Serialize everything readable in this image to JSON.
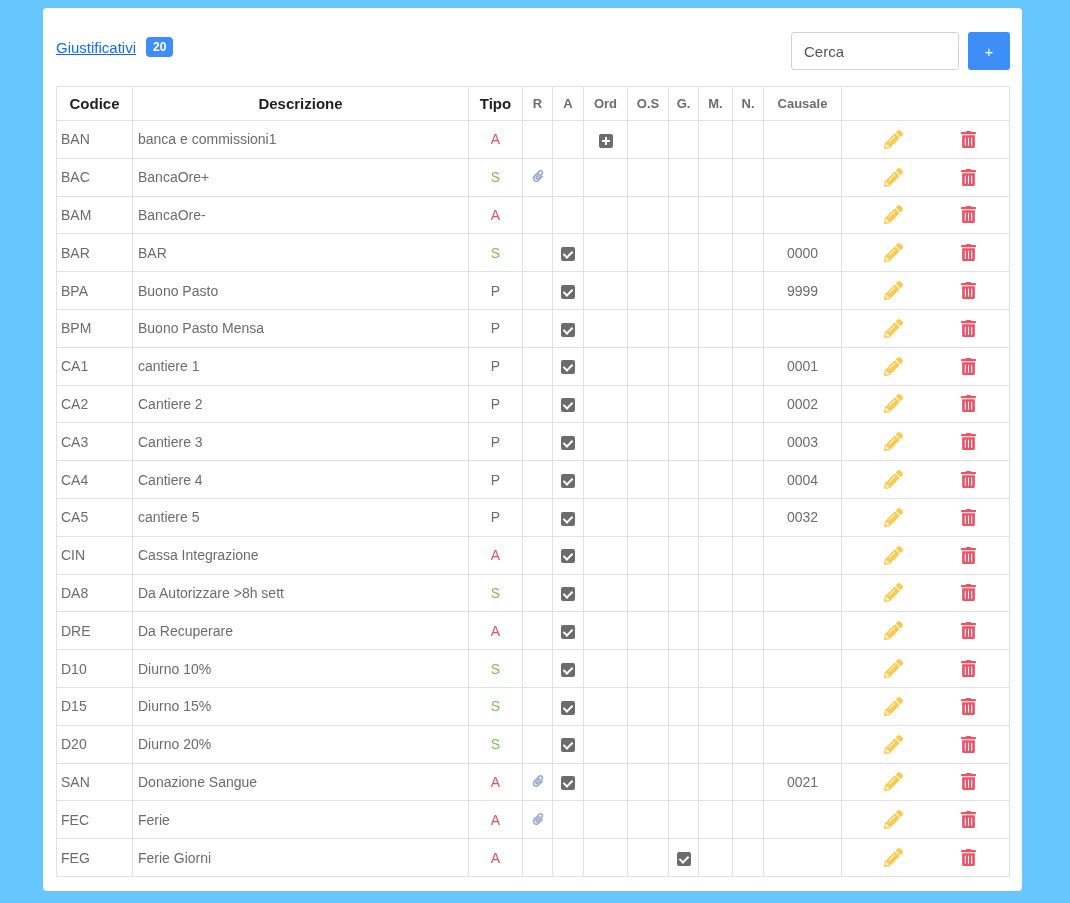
{
  "header": {
    "title": "Giustificativi",
    "count": "20",
    "search": {
      "placeholder": "Cerca"
    },
    "add_button": "+"
  },
  "table": {
    "columns": [
      {
        "label": "Codice",
        "bold": true
      },
      {
        "label": "Descrizione",
        "bold": true
      },
      {
        "label": "Tipo",
        "bold": true
      },
      {
        "label": "R",
        "bold": false
      },
      {
        "label": "A",
        "bold": false
      },
      {
        "label": "Ord",
        "bold": false
      },
      {
        "label": "O.S",
        "bold": false
      },
      {
        "label": "G.",
        "bold": false
      },
      {
        "label": "M.",
        "bold": false
      },
      {
        "label": "N.",
        "bold": false
      },
      {
        "label": "Causale",
        "bold": false
      }
    ],
    "rows": [
      {
        "codice": "BAN",
        "descrizione": "banca e commissioni1",
        "tipo": "A",
        "color": "#e8505b",
        "attachment": false,
        "a_checked": false,
        "ord_plus": true,
        "g_checked": false,
        "causale": ""
      },
      {
        "codice": "BAC",
        "descrizione": "BancaOre+",
        "tipo": "S",
        "color": "#7cc150",
        "attachment": true,
        "a_checked": false,
        "ord_plus": false,
        "g_checked": false,
        "causale": ""
      },
      {
        "codice": "BAM",
        "descrizione": "BancaOre-",
        "tipo": "A",
        "color": "#e8505b",
        "attachment": false,
        "a_checked": false,
        "ord_plus": false,
        "g_checked": false,
        "causale": ""
      },
      {
        "codice": "BAR",
        "descrizione": "BAR",
        "tipo": "S",
        "color": "#7cc150",
        "attachment": false,
        "a_checked": true,
        "ord_plus": false,
        "g_checked": false,
        "causale": "0000"
      },
      {
        "codice": "BPA",
        "descrizione": "Buono Pasto",
        "tipo": "P",
        "color": "#6c6c6c",
        "attachment": false,
        "a_checked": true,
        "ord_plus": false,
        "g_checked": false,
        "causale": "9999"
      },
      {
        "codice": "BPM",
        "descrizione": "Buono Pasto Mensa",
        "tipo": "P",
        "color": "#6c6c6c",
        "attachment": false,
        "a_checked": true,
        "ord_plus": false,
        "g_checked": false,
        "causale": ""
      },
      {
        "codice": "CA1",
        "descrizione": "cantiere 1",
        "tipo": "P",
        "color": "#6c6c6c",
        "attachment": false,
        "a_checked": true,
        "ord_plus": false,
        "g_checked": false,
        "causale": "0001"
      },
      {
        "codice": "CA2",
        "descrizione": "Cantiere 2",
        "tipo": "P",
        "color": "#6c6c6c",
        "attachment": false,
        "a_checked": true,
        "ord_plus": false,
        "g_checked": false,
        "causale": "0002"
      },
      {
        "codice": "CA3",
        "descrizione": "Cantiere 3",
        "tipo": "P",
        "color": "#6c6c6c",
        "attachment": false,
        "a_checked": true,
        "ord_plus": false,
        "g_checked": false,
        "causale": "0003"
      },
      {
        "codice": "CA4",
        "descrizione": "Cantiere 4",
        "tipo": "P",
        "color": "#6c6c6c",
        "attachment": false,
        "a_checked": true,
        "ord_plus": false,
        "g_checked": false,
        "causale": "0004"
      },
      {
        "codice": "CA5",
        "descrizione": "cantiere 5",
        "tipo": "P",
        "color": "#6c6c6c",
        "attachment": false,
        "a_checked": true,
        "ord_plus": false,
        "g_checked": false,
        "causale": "0032"
      },
      {
        "codice": "CIN",
        "descrizione": "Cassa Integrazione",
        "tipo": "A",
        "color": "#e8505b",
        "attachment": false,
        "a_checked": true,
        "ord_plus": false,
        "g_checked": false,
        "causale": ""
      },
      {
        "codice": "DA8",
        "descrizione": "Da Autorizzare >8h sett",
        "tipo": "S",
        "color": "#7cc150",
        "attachment": false,
        "a_checked": true,
        "ord_plus": false,
        "g_checked": false,
        "causale": ""
      },
      {
        "codice": "DRE",
        "descrizione": "Da Recuperare",
        "tipo": "A",
        "color": "#e8505b",
        "attachment": false,
        "a_checked": true,
        "ord_plus": false,
        "g_checked": false,
        "causale": ""
      },
      {
        "codice": "D10",
        "descrizione": "Diurno 10%",
        "tipo": "S",
        "color": "#7cc150",
        "attachment": false,
        "a_checked": true,
        "ord_plus": false,
        "g_checked": false,
        "causale": ""
      },
      {
        "codice": "D15",
        "descrizione": "Diurno 15%",
        "tipo": "S",
        "color": "#7cc150",
        "attachment": false,
        "a_checked": true,
        "ord_plus": false,
        "g_checked": false,
        "causale": ""
      },
      {
        "codice": "D20",
        "descrizione": "Diurno 20%",
        "tipo": "S",
        "color": "#7cc150",
        "attachment": false,
        "a_checked": true,
        "ord_plus": false,
        "g_checked": false,
        "causale": ""
      },
      {
        "codice": "SAN",
        "descrizione": "Donazione Sangue",
        "tipo": "A",
        "color": "#e8505b",
        "attachment": true,
        "a_checked": true,
        "ord_plus": false,
        "g_checked": false,
        "causale": "0021"
      },
      {
        "codice": "FEC",
        "descrizione": "Ferie",
        "tipo": "A",
        "color": "#e8505b",
        "attachment": true,
        "a_checked": false,
        "ord_plus": false,
        "g_checked": false,
        "causale": ""
      },
      {
        "codice": "FEG",
        "descrizione": "Ferie Giorni",
        "tipo": "A",
        "color": "#e8505b",
        "attachment": false,
        "a_checked": false,
        "ord_plus": false,
        "g_checked": true,
        "causale": ""
      }
    ]
  }
}
